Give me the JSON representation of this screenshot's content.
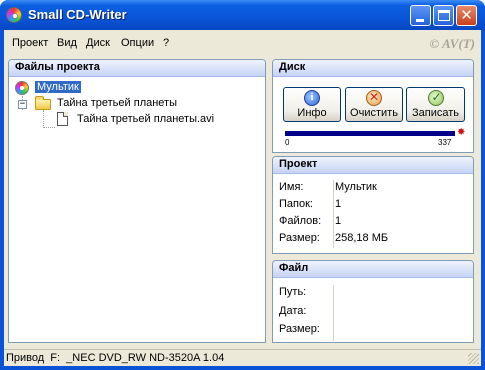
{
  "window": {
    "title": "Small CD-Writer"
  },
  "menu": {
    "items": [
      "Проект",
      "Вид",
      "Диск",
      "Опции",
      "?"
    ],
    "copyright": "© AV(T)"
  },
  "files_panel": {
    "header": "Файлы проекта",
    "tree": [
      {
        "label": "Мультик",
        "icon": "cd-icon",
        "selected": true
      },
      {
        "label": "Тайна третьей планеты",
        "icon": "folder-icon",
        "expanded": true
      },
      {
        "label": "Тайна третьей планеты.avi",
        "icon": "file-icon"
      }
    ]
  },
  "disk_panel": {
    "header": "Диск",
    "buttons": [
      {
        "label": "Инфо",
        "icon": "info-icon"
      },
      {
        "label": "Очистить",
        "icon": "clear-icon"
      },
      {
        "label": "Записать",
        "icon": "write-icon"
      }
    ],
    "progress": {
      "fraction": 1.0,
      "min_label": "0",
      "max_label": "337"
    }
  },
  "project_panel": {
    "header": "Проект",
    "rows": [
      {
        "key": "Имя:",
        "value": "Мультик"
      },
      {
        "key": "Папок:",
        "value": "1"
      },
      {
        "key": "Файлов:",
        "value": "1"
      },
      {
        "key": "Размер:",
        "value": "258,18 МБ"
      }
    ]
  },
  "file_panel": {
    "header": "Файл",
    "rows": [
      {
        "key": "Путь:",
        "value": ""
      },
      {
        "key": "Дата:",
        "value": ""
      },
      {
        "key": "Размер:",
        "value": ""
      }
    ]
  },
  "statusbar": {
    "text": "Привод  F:  _NEC DVD_RW ND-3520A 1.04"
  },
  "colors": {
    "accent": "#0a52d6",
    "selection": "#316ac5",
    "progress": "#00008b"
  }
}
